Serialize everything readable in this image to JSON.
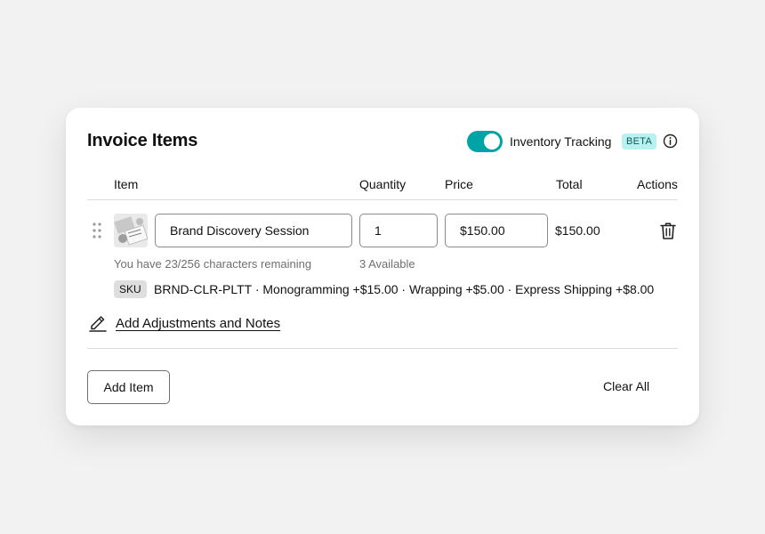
{
  "card": {
    "title": "Invoice Items",
    "inventory_toggle": {
      "label": "Inventory Tracking",
      "on": true,
      "badge": "BETA",
      "accent": "#00a4a6"
    }
  },
  "table": {
    "headers": {
      "item": "Item",
      "quantity": "Quantity",
      "price": "Price",
      "total": "Total",
      "actions": "Actions"
    }
  },
  "line_item": {
    "name": "Brand Discovery Session",
    "quantity": "1",
    "price": "$150.00",
    "total": "$150.00",
    "char_hint": "You have 23/256 characters remaining",
    "availability": "3 Available",
    "sku_label": "SKU",
    "sku_details": "BRND-CLR-PLTT · Monogramming +$15.00 · Wrapping +$5.00 · Express Shipping +$8.00",
    "adjustments_link": "Add Adjustments and Notes"
  },
  "footer": {
    "add_label": "Add Item",
    "clear_label": "Clear All"
  },
  "icons": [
    "info-icon",
    "drag-handle-icon",
    "trash-icon",
    "pencil-icon"
  ]
}
